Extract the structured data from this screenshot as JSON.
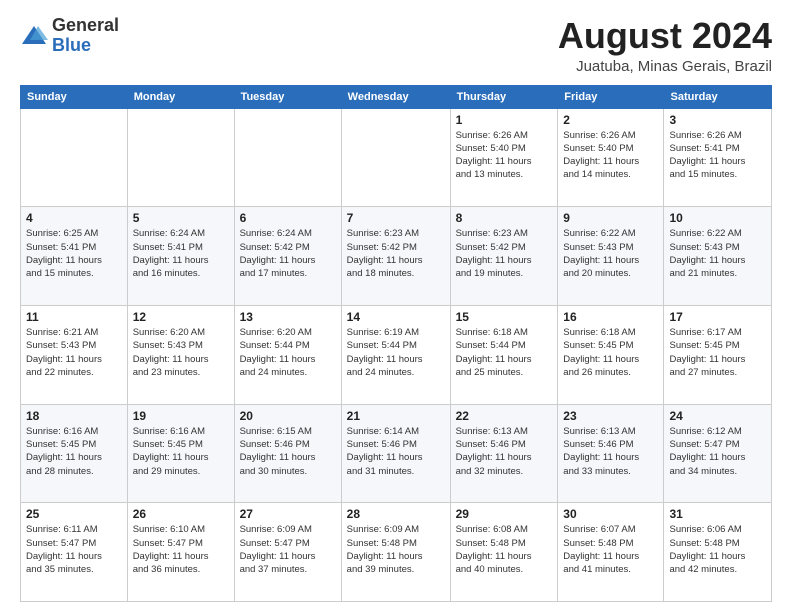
{
  "header": {
    "logo": {
      "general": "General",
      "blue": "Blue"
    },
    "title": "August 2024",
    "location": "Juatuba, Minas Gerais, Brazil"
  },
  "days_of_week": [
    "Sunday",
    "Monday",
    "Tuesday",
    "Wednesday",
    "Thursday",
    "Friday",
    "Saturday"
  ],
  "weeks": [
    [
      {
        "day": "",
        "info": ""
      },
      {
        "day": "",
        "info": ""
      },
      {
        "day": "",
        "info": ""
      },
      {
        "day": "",
        "info": ""
      },
      {
        "day": "1",
        "info": "Sunrise: 6:26 AM\nSunset: 5:40 PM\nDaylight: 11 hours\nand 13 minutes."
      },
      {
        "day": "2",
        "info": "Sunrise: 6:26 AM\nSunset: 5:40 PM\nDaylight: 11 hours\nand 14 minutes."
      },
      {
        "day": "3",
        "info": "Sunrise: 6:26 AM\nSunset: 5:41 PM\nDaylight: 11 hours\nand 15 minutes."
      }
    ],
    [
      {
        "day": "4",
        "info": "Sunrise: 6:25 AM\nSunset: 5:41 PM\nDaylight: 11 hours\nand 15 minutes."
      },
      {
        "day": "5",
        "info": "Sunrise: 6:24 AM\nSunset: 5:41 PM\nDaylight: 11 hours\nand 16 minutes."
      },
      {
        "day": "6",
        "info": "Sunrise: 6:24 AM\nSunset: 5:42 PM\nDaylight: 11 hours\nand 17 minutes."
      },
      {
        "day": "7",
        "info": "Sunrise: 6:23 AM\nSunset: 5:42 PM\nDaylight: 11 hours\nand 18 minutes."
      },
      {
        "day": "8",
        "info": "Sunrise: 6:23 AM\nSunset: 5:42 PM\nDaylight: 11 hours\nand 19 minutes."
      },
      {
        "day": "9",
        "info": "Sunrise: 6:22 AM\nSunset: 5:43 PM\nDaylight: 11 hours\nand 20 minutes."
      },
      {
        "day": "10",
        "info": "Sunrise: 6:22 AM\nSunset: 5:43 PM\nDaylight: 11 hours\nand 21 minutes."
      }
    ],
    [
      {
        "day": "11",
        "info": "Sunrise: 6:21 AM\nSunset: 5:43 PM\nDaylight: 11 hours\nand 22 minutes."
      },
      {
        "day": "12",
        "info": "Sunrise: 6:20 AM\nSunset: 5:43 PM\nDaylight: 11 hours\nand 23 minutes."
      },
      {
        "day": "13",
        "info": "Sunrise: 6:20 AM\nSunset: 5:44 PM\nDaylight: 11 hours\nand 24 minutes."
      },
      {
        "day": "14",
        "info": "Sunrise: 6:19 AM\nSunset: 5:44 PM\nDaylight: 11 hours\nand 24 minutes."
      },
      {
        "day": "15",
        "info": "Sunrise: 6:18 AM\nSunset: 5:44 PM\nDaylight: 11 hours\nand 25 minutes."
      },
      {
        "day": "16",
        "info": "Sunrise: 6:18 AM\nSunset: 5:45 PM\nDaylight: 11 hours\nand 26 minutes."
      },
      {
        "day": "17",
        "info": "Sunrise: 6:17 AM\nSunset: 5:45 PM\nDaylight: 11 hours\nand 27 minutes."
      }
    ],
    [
      {
        "day": "18",
        "info": "Sunrise: 6:16 AM\nSunset: 5:45 PM\nDaylight: 11 hours\nand 28 minutes."
      },
      {
        "day": "19",
        "info": "Sunrise: 6:16 AM\nSunset: 5:45 PM\nDaylight: 11 hours\nand 29 minutes."
      },
      {
        "day": "20",
        "info": "Sunrise: 6:15 AM\nSunset: 5:46 PM\nDaylight: 11 hours\nand 30 minutes."
      },
      {
        "day": "21",
        "info": "Sunrise: 6:14 AM\nSunset: 5:46 PM\nDaylight: 11 hours\nand 31 minutes."
      },
      {
        "day": "22",
        "info": "Sunrise: 6:13 AM\nSunset: 5:46 PM\nDaylight: 11 hours\nand 32 minutes."
      },
      {
        "day": "23",
        "info": "Sunrise: 6:13 AM\nSunset: 5:46 PM\nDaylight: 11 hours\nand 33 minutes."
      },
      {
        "day": "24",
        "info": "Sunrise: 6:12 AM\nSunset: 5:47 PM\nDaylight: 11 hours\nand 34 minutes."
      }
    ],
    [
      {
        "day": "25",
        "info": "Sunrise: 6:11 AM\nSunset: 5:47 PM\nDaylight: 11 hours\nand 35 minutes."
      },
      {
        "day": "26",
        "info": "Sunrise: 6:10 AM\nSunset: 5:47 PM\nDaylight: 11 hours\nand 36 minutes."
      },
      {
        "day": "27",
        "info": "Sunrise: 6:09 AM\nSunset: 5:47 PM\nDaylight: 11 hours\nand 37 minutes."
      },
      {
        "day": "28",
        "info": "Sunrise: 6:09 AM\nSunset: 5:48 PM\nDaylight: 11 hours\nand 39 minutes."
      },
      {
        "day": "29",
        "info": "Sunrise: 6:08 AM\nSunset: 5:48 PM\nDaylight: 11 hours\nand 40 minutes."
      },
      {
        "day": "30",
        "info": "Sunrise: 6:07 AM\nSunset: 5:48 PM\nDaylight: 11 hours\nand 41 minutes."
      },
      {
        "day": "31",
        "info": "Sunrise: 6:06 AM\nSunset: 5:48 PM\nDaylight: 11 hours\nand 42 minutes."
      }
    ]
  ]
}
